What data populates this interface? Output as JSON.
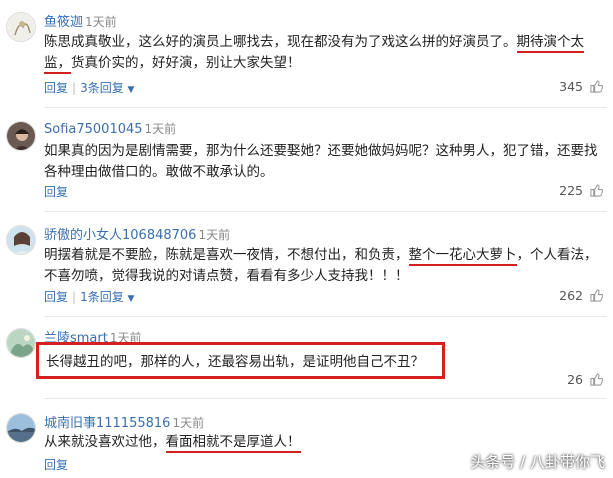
{
  "comments": [
    {
      "username": "鱼筱迦",
      "time": "1天前",
      "text_before": "陈思成真敬业，这么好的演员上哪找去，现在都没有为了戏这么拼的好演员了。",
      "text_underlined": "期待演个太监，",
      "text_after": "货真价实的，好好演，别让大家失望！",
      "reply": "回复",
      "replies": "3条回复",
      "likes": "345"
    },
    {
      "username": "Sofia75001045",
      "time": "1天前",
      "text": "如果真的因为是剧情需要，那为什么还要娶她？还要她做妈妈呢？这种男人，犯了错，还要找各种理由做借口的。敢做不敢承认的。",
      "reply": "回复",
      "likes": "225"
    },
    {
      "username": "骄傲的小女人106848706",
      "time": "1天前",
      "text_before": "明摆着就是不要脸，陈就是喜欢一夜情，不想付出，和负责，",
      "text_underlined": "整个一花心大萝卜",
      "text_after": "，个人看法，不喜勿喷，觉得我说的对请点赞，看看有多少人支持我！！！",
      "reply": "回复",
      "replies": "1条回复",
      "likes": "262"
    },
    {
      "username": "兰陵smart",
      "time": "1天前",
      "text": "长得越丑的吧，那样的人，还最容易出轨，是证明他自己不丑？",
      "likes": "26"
    },
    {
      "username": "城南旧事111155816",
      "time": "1天前",
      "text_before": "从来就没喜欢过他，",
      "text_underlined": "看面相就不是厚道人！",
      "reply": "回复"
    }
  ],
  "watermark": "头条号 / 八卦带你飞",
  "colors": {
    "highlight": "#d62020",
    "link": "#3a6fb0"
  }
}
